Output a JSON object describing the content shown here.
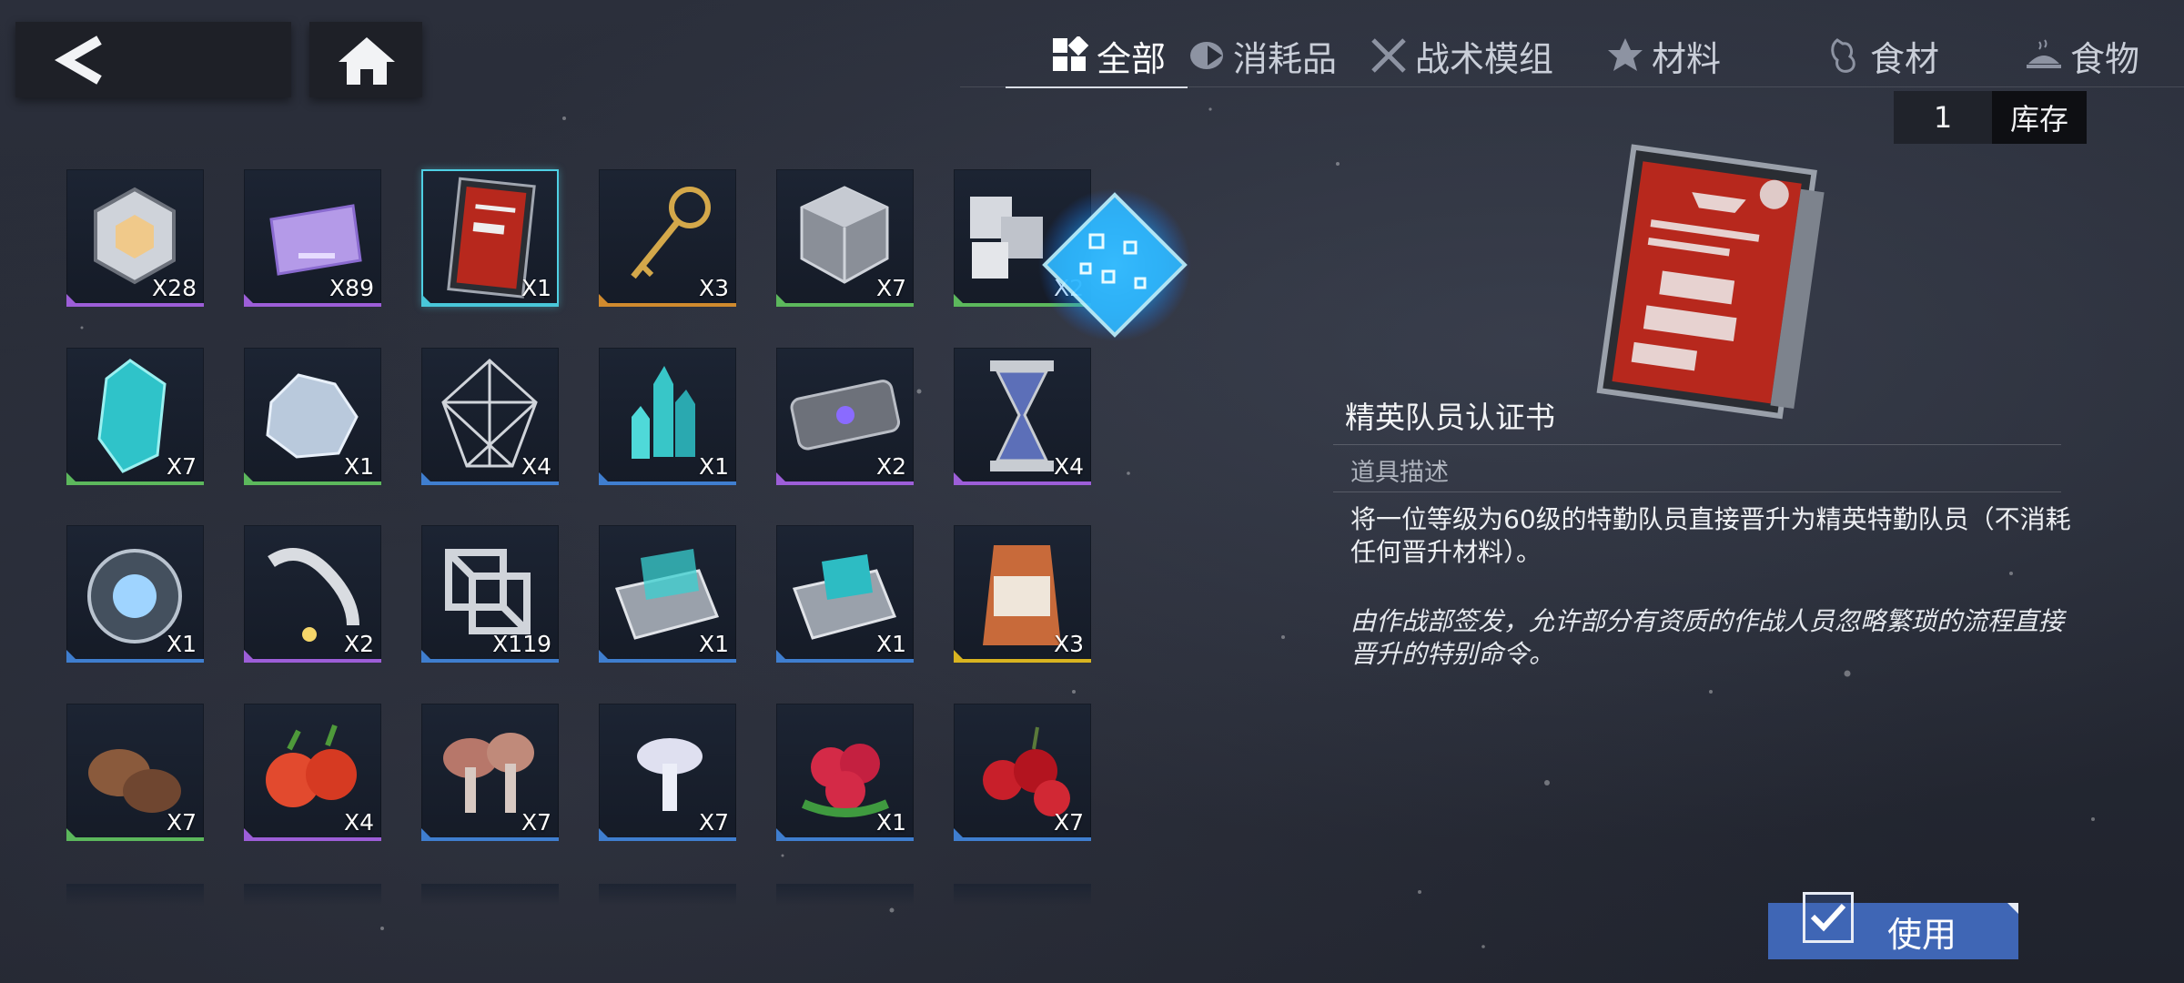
{
  "tabs": [
    {
      "label": "全部",
      "icon": "all-grid-icon",
      "active": true
    },
    {
      "label": "消耗品",
      "icon": "consumable-icon",
      "active": false
    },
    {
      "label": "战术模组",
      "icon": "tactical-module-icon",
      "active": false
    },
    {
      "label": "材料",
      "icon": "material-icon",
      "active": false
    },
    {
      "label": "食材",
      "icon": "ingredient-icon",
      "active": false
    },
    {
      "label": "食物",
      "icon": "food-icon",
      "active": false
    }
  ],
  "stock": {
    "value": "1",
    "label": "库存"
  },
  "items": [
    {
      "name": "hex-core",
      "qty": "X28",
      "rarity": "purple"
    },
    {
      "name": "purple-card",
      "qty": "X89",
      "rarity": "purple"
    },
    {
      "name": "elite-certificate",
      "qty": "X1",
      "rarity": "cyan",
      "selected": true
    },
    {
      "name": "golden-key",
      "qty": "X3",
      "rarity": "orange"
    },
    {
      "name": "metal-cube",
      "qty": "X7",
      "rarity": "green"
    },
    {
      "name": "silver-blocks",
      "qty": "X2",
      "rarity": "green"
    },
    {
      "name": "teal-crystal",
      "qty": "X7",
      "rarity": "green"
    },
    {
      "name": "ice-crystal",
      "qty": "X1",
      "rarity": "green"
    },
    {
      "name": "wire-polyhedron",
      "qty": "X4",
      "rarity": "blue"
    },
    {
      "name": "crystal-cluster",
      "qty": "X1",
      "rarity": "blue"
    },
    {
      "name": "tech-capsule",
      "qty": "X2",
      "rarity": "purple"
    },
    {
      "name": "hourglass",
      "qty": "X4",
      "rarity": "purple"
    },
    {
      "name": "reactor-core",
      "qty": "X1",
      "rarity": "blue"
    },
    {
      "name": "robotic-arm",
      "qty": "X2",
      "rarity": "purple"
    },
    {
      "name": "metal-lattice",
      "qty": "X119",
      "rarity": "blue"
    },
    {
      "name": "supply-box-blue",
      "qty": "X1",
      "rarity": "blue"
    },
    {
      "name": "supply-box-teal",
      "qty": "X1",
      "rarity": "blue"
    },
    {
      "name": "coffee-bag",
      "qty": "X3",
      "rarity": "gold"
    },
    {
      "name": "potatoes",
      "qty": "X7",
      "rarity": "green"
    },
    {
      "name": "tomatoes",
      "qty": "X4",
      "rarity": "purple"
    },
    {
      "name": "brown-mushrooms",
      "qty": "X7",
      "rarity": "blue"
    },
    {
      "name": "white-mushroom",
      "qty": "X7",
      "rarity": "blue"
    },
    {
      "name": "raspberries",
      "qty": "X1",
      "rarity": "blue"
    },
    {
      "name": "red-berries",
      "qty": "X7",
      "rarity": "blue"
    }
  ],
  "detail": {
    "title": "精英队员认证书",
    "section_label": "道具描述",
    "description": "将一位等级为60级的特勤队员直接晋升为精英特勤队员（不消耗任何晋升材料）。",
    "lore": "由作战部签发，允许部分有资质的作战人员忽略繁琐的流程直接晋升的特别命令。"
  },
  "actions": {
    "use_label": "使用"
  },
  "colors": {
    "accent": "#3f66b5",
    "selected": "#4fd0e4",
    "background": "#262a35"
  }
}
